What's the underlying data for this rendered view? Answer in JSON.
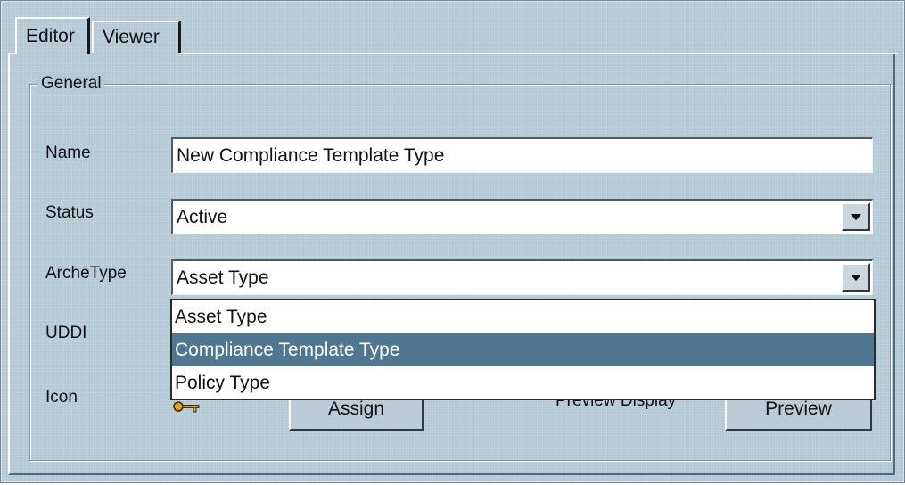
{
  "tabs": [
    {
      "label": "Editor",
      "active": true
    },
    {
      "label": "Viewer",
      "active": false
    }
  ],
  "group": {
    "title": "General"
  },
  "form": {
    "name_label": "Name",
    "name_value": "New Compliance Template Type",
    "status_label": "Status",
    "status_value": "Active",
    "archetype_label": "ArcheType",
    "archetype_value": "Asset Type",
    "uddi_label": "UDDI",
    "icon_label": "Icon",
    "assign_label": "Assign",
    "preview_display_label": "Preview Display",
    "preview_label": "Preview"
  },
  "archetype_options": [
    {
      "label": "Asset Type",
      "selected": false
    },
    {
      "label": "Compliance Template Type",
      "selected": true
    },
    {
      "label": "Policy Type",
      "selected": false
    }
  ],
  "icons": {
    "icon_preview": "key-icon",
    "combo_arrow": "chevron-down-icon"
  },
  "colors": {
    "window_bg": "#b3c9d6",
    "selection": "#4f7791"
  }
}
